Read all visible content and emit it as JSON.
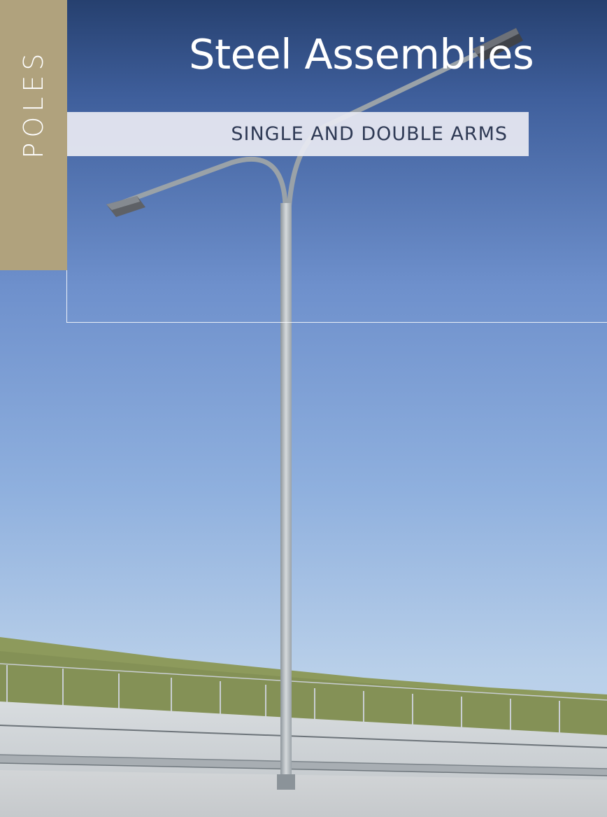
{
  "side_tab": {
    "label": "POLES"
  },
  "header": {
    "title": "Steel Assemblies",
    "subtitle": "SINGLE AND DOUBLE ARMS"
  },
  "colors": {
    "tab_background": "#b0a27d",
    "sky_top": "#2b4474",
    "sky_bottom": "#c9dcef",
    "subtitle_band": "#e8eaf2",
    "subtitle_text": "#2f3a55"
  },
  "photo": {
    "subject": "double-arm-street-light-pole"
  }
}
